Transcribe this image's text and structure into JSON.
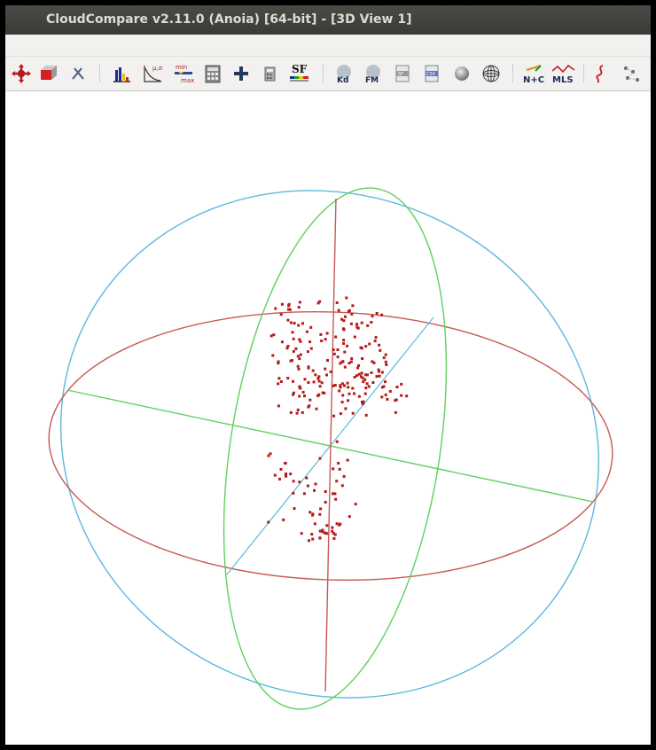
{
  "window": {
    "title": "CloudCompare v2.11.0 (Anoia) [64-bit] - [3D View 1]"
  },
  "toolbar": {
    "items": [
      {
        "name": "translate-rotate-icon"
      },
      {
        "name": "segment-icon"
      },
      {
        "name": "pick-points-icon"
      },
      {
        "name": "histogram-icon"
      },
      {
        "name": "fit-distribution-icon",
        "label": "μ,σ"
      },
      {
        "name": "filter-by-value-icon",
        "label_top": "min",
        "label_bottom": "max"
      },
      {
        "name": "scalar-field-calculator-icon"
      },
      {
        "name": "add-constant-sf-icon"
      },
      {
        "name": "calculator-icon"
      },
      {
        "name": "sf-color-scale-icon",
        "label": "SF"
      },
      {
        "name": "kd-tree-icon",
        "label": "Kd"
      },
      {
        "name": "fm-icon",
        "label": "FM"
      },
      {
        "name": "export-sf-icon",
        "label": "SF"
      },
      {
        "name": "export-csv-icon",
        "label": "CSV"
      },
      {
        "name": "sphere-shading-icon"
      },
      {
        "name": "wireframe-sphere-icon"
      },
      {
        "name": "compute-normals-icon",
        "label": "N+C"
      },
      {
        "name": "mls-smoothing-icon",
        "label": "MLS"
      },
      {
        "name": "curve-icon"
      },
      {
        "name": "points-graph-icon"
      }
    ]
  },
  "colors": {
    "x_axis": "#5fd05f",
    "y_axis": "#5bb8de",
    "z_axis": "#c85a54",
    "points": "#b51a1a"
  }
}
